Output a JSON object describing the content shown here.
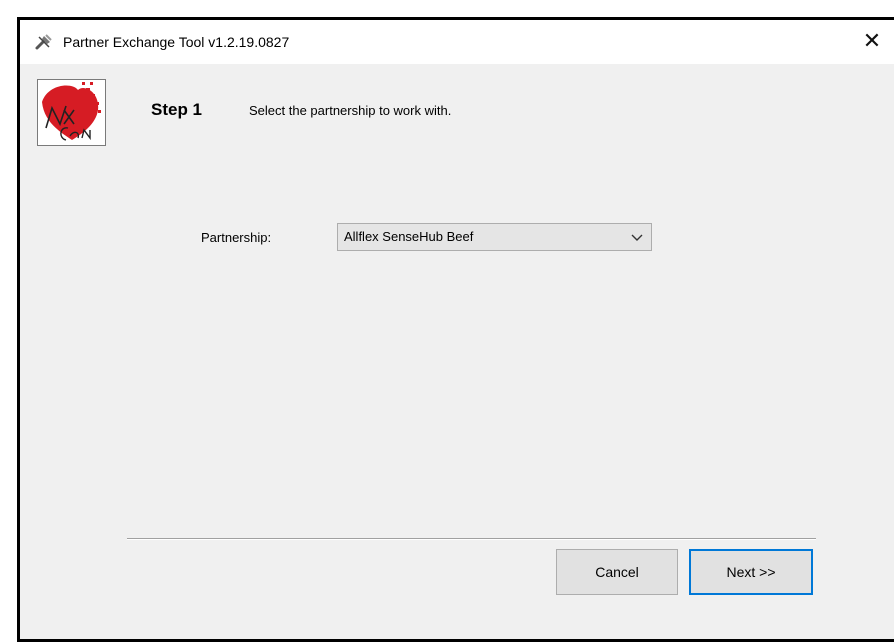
{
  "window": {
    "title": "Partner Exchange Tool v1.2.19.0827",
    "close_glyph": "✕",
    "icons": {
      "app": "tools-icon",
      "close": "close-icon"
    }
  },
  "header": {
    "step_label": "Step 1",
    "description": "Select the partnership to work with.",
    "logo": "company-logo"
  },
  "form": {
    "partnership_label": "Partnership:",
    "partnership_value": "Allflex SenseHub Beef"
  },
  "footer": {
    "cancel_label": "Cancel",
    "next_label": "Next >>"
  },
  "colors": {
    "window_bg": "#f0f0f0",
    "titlebar_bg": "#ffffff",
    "focus_border": "#0078d7",
    "logo_accent": "#d61c24"
  }
}
